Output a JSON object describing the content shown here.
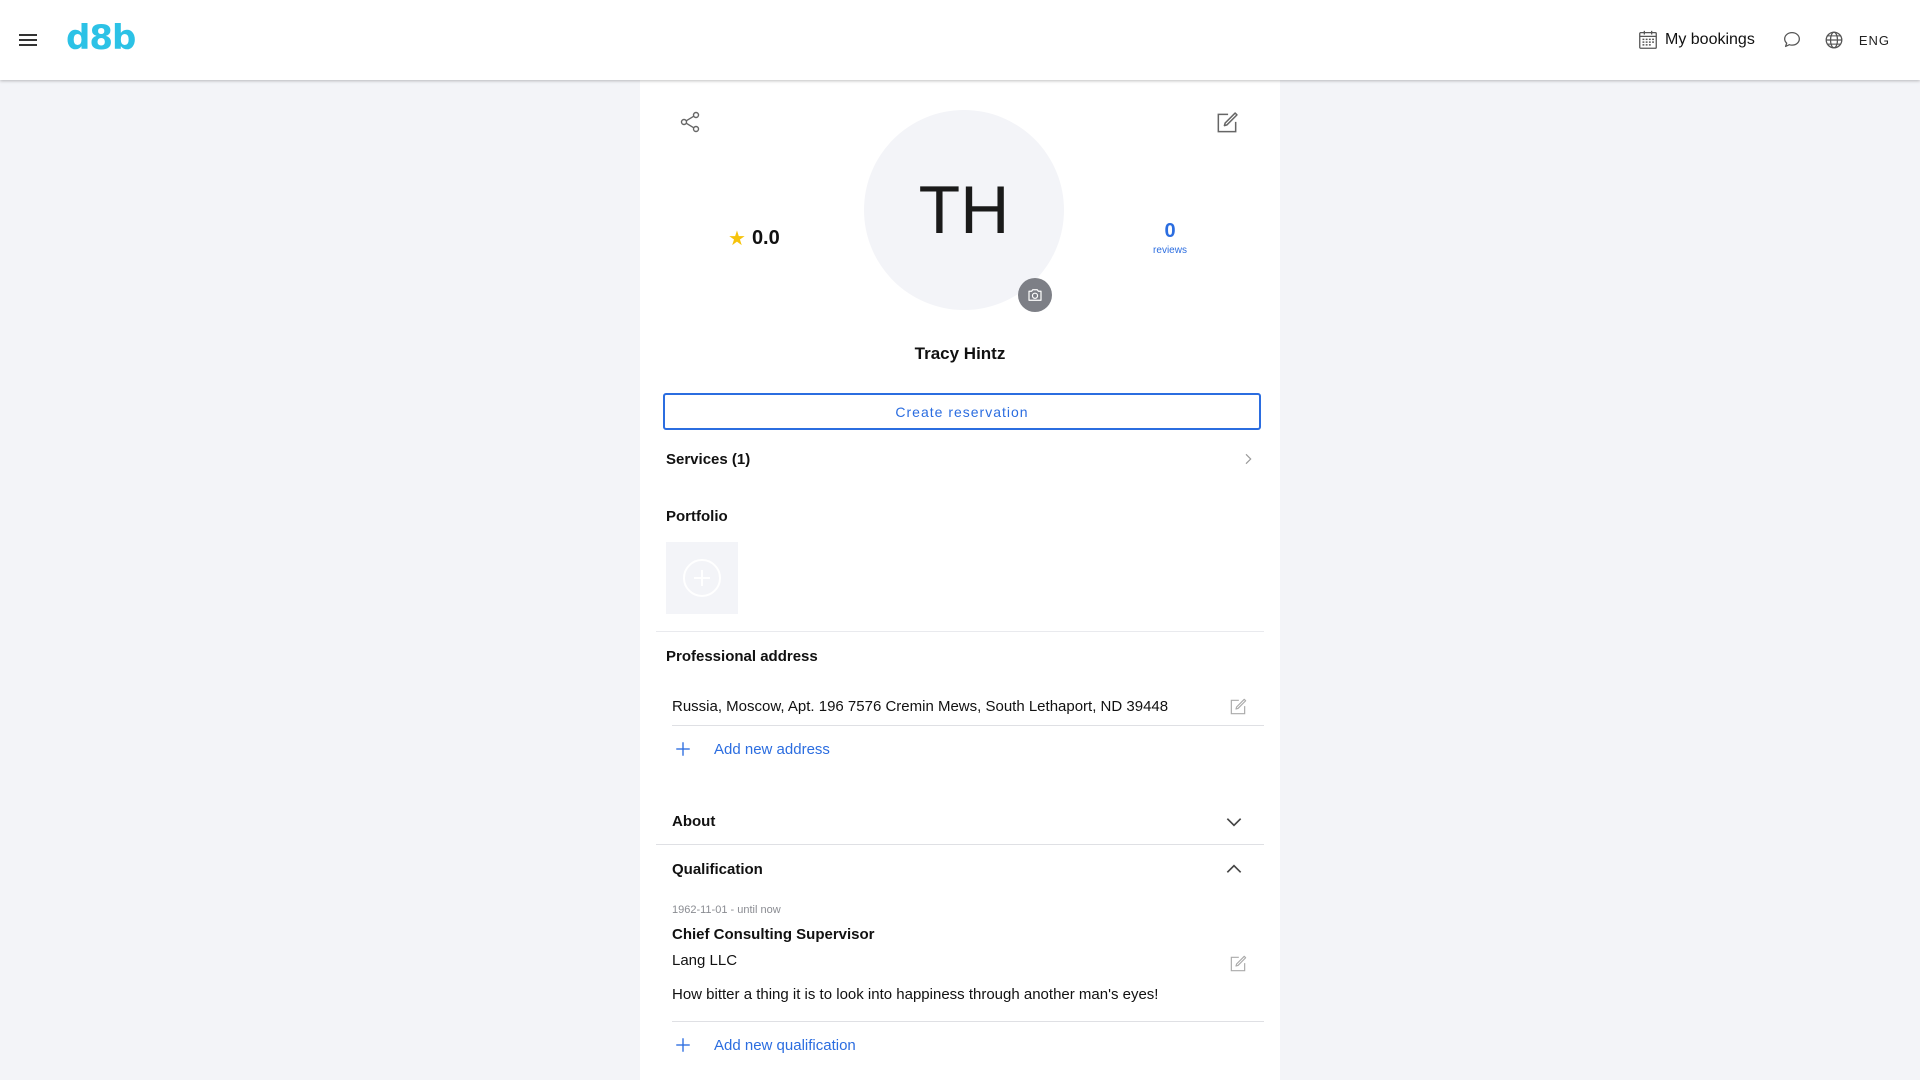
{
  "header": {
    "logo": "d8b",
    "bookings_label": "My bookings",
    "language": "ENG"
  },
  "profile": {
    "initials": "TH",
    "rating": "0.0",
    "reviews_count": "0",
    "reviews_label": "reviews",
    "name": "Tracy Hintz",
    "create_reservation_label": "Create reservation"
  },
  "services": {
    "label": "Services (1)"
  },
  "portfolio": {
    "title": "Portfolio"
  },
  "address": {
    "title": "Professional address",
    "items": [
      "Russia, Moscow, Apt. 196 7576 Cremin Mews, South Lethaport, ND 39448"
    ],
    "add_label": "Add new address"
  },
  "about": {
    "title": "About",
    "expanded": false
  },
  "qualification": {
    "title": "Qualification",
    "expanded": true,
    "items": [
      {
        "dates": "1962-11-01 - until now",
        "position": "Chief Consulting Supervisor",
        "company": "Lang LLC",
        "description": "How bitter a thing it is to look into happiness through another man's eyes!"
      }
    ],
    "add_label": "Add new qualification"
  },
  "colors": {
    "brand": "#2cc2e6",
    "accent": "#2b6de0",
    "star": "#f6c30b",
    "background": "#f3f4f8"
  },
  "icons": [
    "menu-icon",
    "calendar-icon",
    "chat-icon",
    "globe-icon",
    "share-icon",
    "edit-icon",
    "camera-icon",
    "star-icon",
    "chevron-right-icon",
    "plus-circle-icon",
    "plus-icon",
    "chevron-down-icon",
    "chevron-up-icon"
  ]
}
